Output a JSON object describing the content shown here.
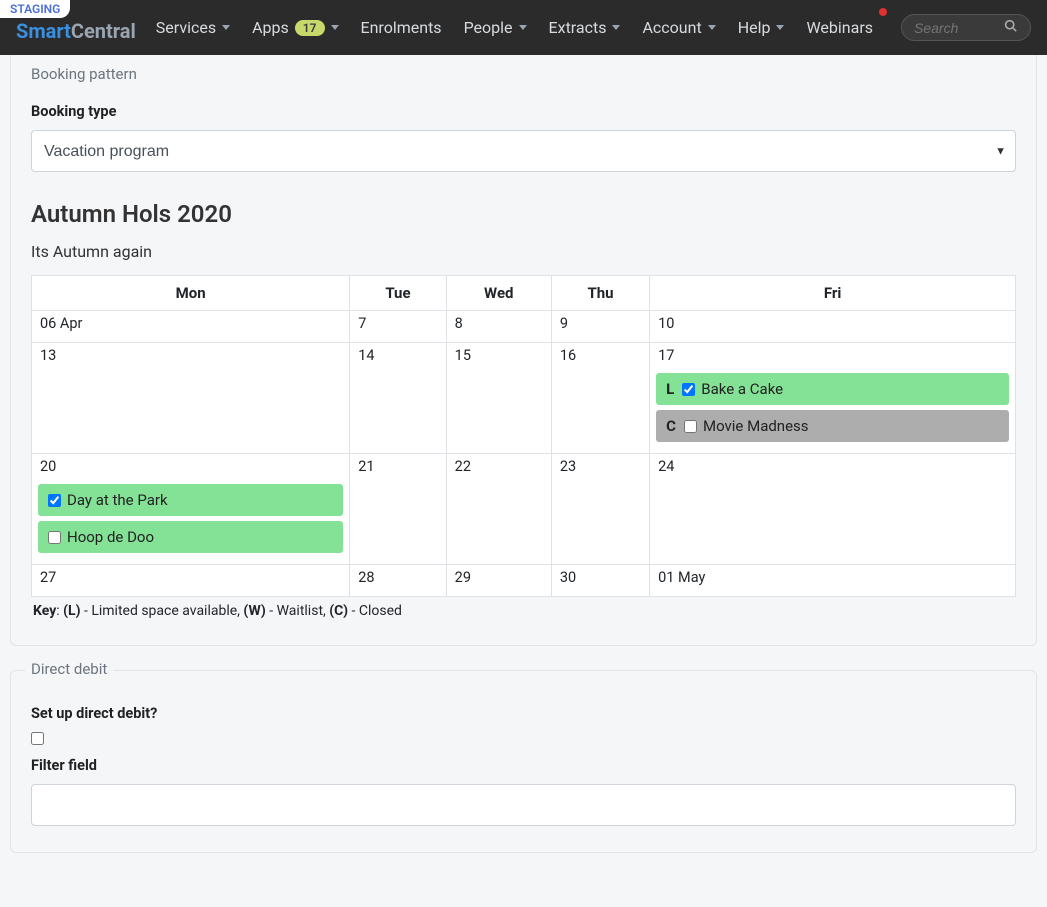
{
  "env_badge": "STAGING",
  "brand": {
    "part1": "Smart",
    "part2": "Central"
  },
  "nav": {
    "services": "Services",
    "apps": "Apps",
    "apps_count": "17",
    "enrolments": "Enrolments",
    "people": "People",
    "extracts": "Extracts",
    "account": "Account",
    "help": "Help",
    "webinars": "Webinars"
  },
  "search": {
    "placeholder": "Search"
  },
  "booking": {
    "legend": "Booking pattern",
    "type_label": "Booking type",
    "type_value": "Vacation program",
    "program_title": "Autumn Hols 2020",
    "program_subtitle": "Its Autumn again",
    "days": [
      "Mon",
      "Tue",
      "Wed",
      "Thu",
      "Fri"
    ],
    "rows": [
      [
        "06 Apr",
        "7",
        "8",
        "9",
        "10"
      ],
      [
        "13",
        "14",
        "15",
        "16",
        "17"
      ],
      [
        "20",
        "21",
        "22",
        "23",
        "24"
      ],
      [
        "27",
        "28",
        "29",
        "30",
        "01 May"
      ]
    ],
    "events": {
      "fri17": [
        {
          "flag": "L",
          "checked": true,
          "label": "Bake a Cake",
          "style": "green"
        },
        {
          "flag": "C",
          "checked": false,
          "label": "Movie Madness",
          "style": "grey"
        }
      ],
      "mon20": [
        {
          "flag": "",
          "checked": true,
          "label": "Day at the Park",
          "style": "green"
        },
        {
          "flag": "",
          "checked": false,
          "label": "Hoop de Doo",
          "style": "green"
        }
      ]
    },
    "key_prefix": "Key",
    "key_l": "(L)",
    "key_l_text": " - Limited space available, ",
    "key_w": "(W)",
    "key_w_text": " - Waitlist, ",
    "key_c": "(C)",
    "key_c_text": " - Closed"
  },
  "debit": {
    "legend": "Direct debit",
    "setup_label": "Set up direct debit?",
    "filter_label": "Filter field"
  }
}
